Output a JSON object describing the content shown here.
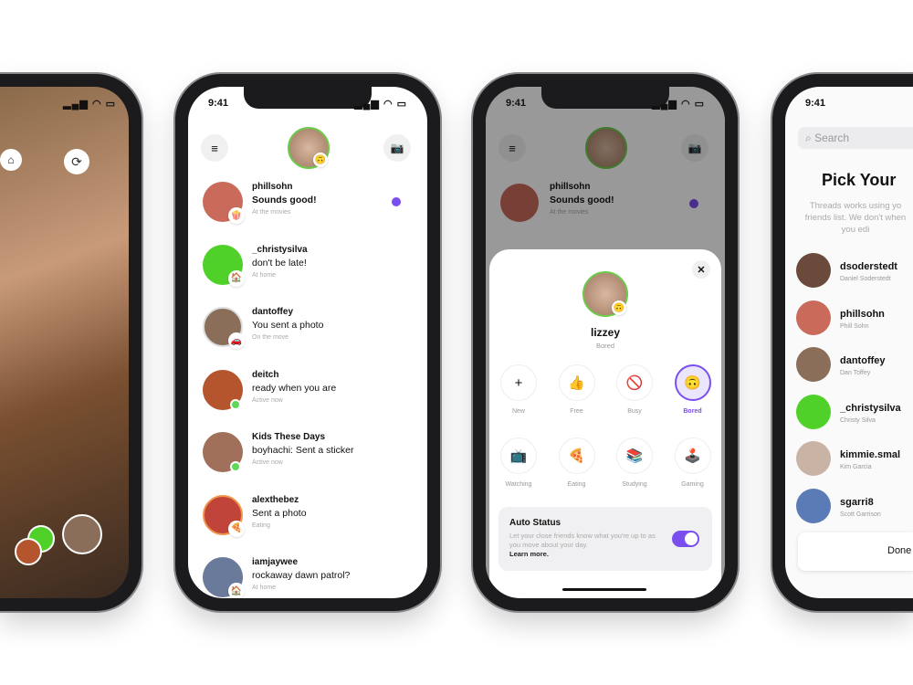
{
  "status_time": "9:41",
  "camera": {
    "home_icon": "home-icon",
    "flip_icon": "camera-flip-icon"
  },
  "inbox": {
    "threads": [
      {
        "name": "phillsohn",
        "message": "Sounds good!",
        "status": "At the movies",
        "emoji": "🍿",
        "unread": true,
        "avatar": "#c96a5a"
      },
      {
        "name": "_christysilva",
        "message": "don't be late!",
        "status": "At home",
        "emoji": "🏠",
        "unread": false,
        "avatar": "#4fd12a"
      },
      {
        "name": "dantoffey",
        "message": "You sent a photo",
        "status": "On the move",
        "emoji": "🚗",
        "unread": false,
        "avatar": "#8a6e5a"
      },
      {
        "name": "deitch",
        "message": "ready when you are",
        "status": "Active now",
        "emoji": "",
        "unread": false,
        "avatar": "#b5552e"
      },
      {
        "name": "Kids These Days",
        "message": "boyhachi: Sent a sticker",
        "status": "Active now",
        "emoji": "",
        "unread": false,
        "avatar": "#a0705a"
      },
      {
        "name": "alexthebez",
        "message": "Sent a photo",
        "status": "Eating",
        "emoji": "🍕",
        "unread": false,
        "avatar": "#c0443a"
      },
      {
        "name": "iamjaywee",
        "message": "rockaway dawn patrol?",
        "status": "At home",
        "emoji": "🏠",
        "unread": false,
        "avatar": "#6a7a9a"
      }
    ]
  },
  "status_sheet": {
    "username": "lizzey",
    "current_status": "Bored",
    "options": [
      {
        "label": "New",
        "emoji": "+"
      },
      {
        "label": "Free",
        "emoji": "👍"
      },
      {
        "label": "Busy",
        "emoji": "🚫"
      },
      {
        "label": "Bored",
        "emoji": "🙃",
        "selected": true
      },
      {
        "label": "Watching",
        "emoji": "📺"
      },
      {
        "label": "Eating",
        "emoji": "🍕"
      },
      {
        "label": "Studying",
        "emoji": "📚"
      },
      {
        "label": "Gaming",
        "emoji": "🕹️"
      }
    ],
    "auto_status": {
      "title": "Auto Status",
      "description": "Let your close friends know what you're up to as you move about your day.",
      "link": "Learn more.",
      "enabled": true
    }
  },
  "pick": {
    "search_placeholder": "Search",
    "title": "Pick Your",
    "description": "Threads works using yo friends list. We don't when you edi",
    "friends": [
      {
        "username": "dsoderstedt",
        "name": "Daniel Soderstedt",
        "avatar": "#6a4a3a"
      },
      {
        "username": "phillsohn",
        "name": "Phill Sohn",
        "avatar": "#c96a5a"
      },
      {
        "username": "dantoffey",
        "name": "Dan Toffey",
        "avatar": "#8a6e5a"
      },
      {
        "username": "_christysilva",
        "name": "Christy Silva",
        "avatar": "#4fd12a"
      },
      {
        "username": "kimmie.smal",
        "name": "Kim Garcia",
        "avatar": "#c9b3a5"
      },
      {
        "username": "sgarri8",
        "name": "Scott Garrison",
        "avatar": "#5a7bb5"
      }
    ],
    "done_label": "Done"
  },
  "colors": {
    "accent": "#7b4ef0",
    "online": "#5fd85a",
    "ring": "#6ccb4b"
  }
}
